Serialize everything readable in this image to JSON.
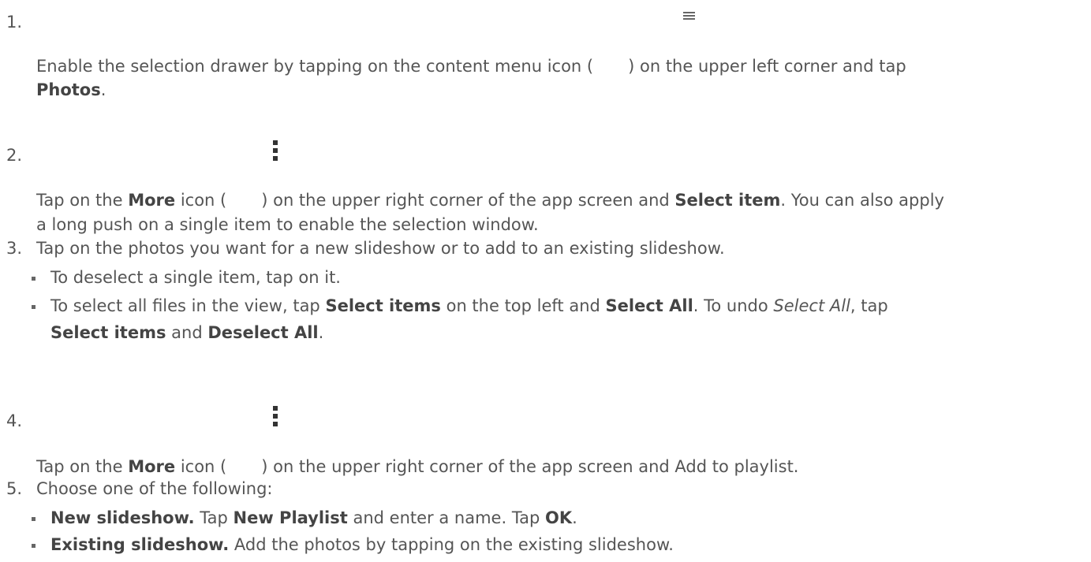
{
  "steps": [
    {
      "number": "1.",
      "icon": "menu-icon",
      "line1_a": "Enable the selection drawer by tapping on the content menu icon (",
      "line1_b": ") on the upper left corner and tap",
      "line2_bold": "Photos",
      "line2_tail": "."
    },
    {
      "number": "2.",
      "icon": "more-vertical-icon",
      "t1": "Tap on the ",
      "b1": "More",
      "t2": " icon (",
      "t3": ") on the upper right corner of the app screen and ",
      "b2": "Select item",
      "t4": ". You can also apply",
      "line2": "a long push on a single item to enable the selection window."
    },
    {
      "number": "3.",
      "text": "Tap on the photos you want for a new slideshow or to add to an existing slideshow.",
      "sub": [
        {
          "text": "To deselect a single item, tap on it."
        },
        {
          "t1": "To select all files in the view, tap ",
          "b1": "Select items",
          "t2": " on the top left and ",
          "b2": "Select All",
          "t3": ". To undo ",
          "i1": "Select All",
          "t4": ", tap",
          "b3": "Select items",
          "t5": " and ",
          "b4": "Deselect All",
          "t6": "."
        }
      ]
    },
    {
      "number": "4.",
      "icon": "more-vertical-icon",
      "t1": "Tap on the ",
      "b1": "More",
      "t2": " icon (",
      "t3": ") on the upper right corner of the app screen and Add to playlist."
    },
    {
      "number": "5.",
      "text": "Choose one of the following:",
      "sub": [
        {
          "b1": "New slideshow.",
          "t1": " Tap ",
          "b2": "New Playlist",
          "t2": " and enter a name. Tap ",
          "b3": "OK",
          "t3": "."
        },
        {
          "b1": "Existing slideshow.",
          "t1": " Add the photos by tapping on the existing slideshow."
        }
      ]
    }
  ]
}
